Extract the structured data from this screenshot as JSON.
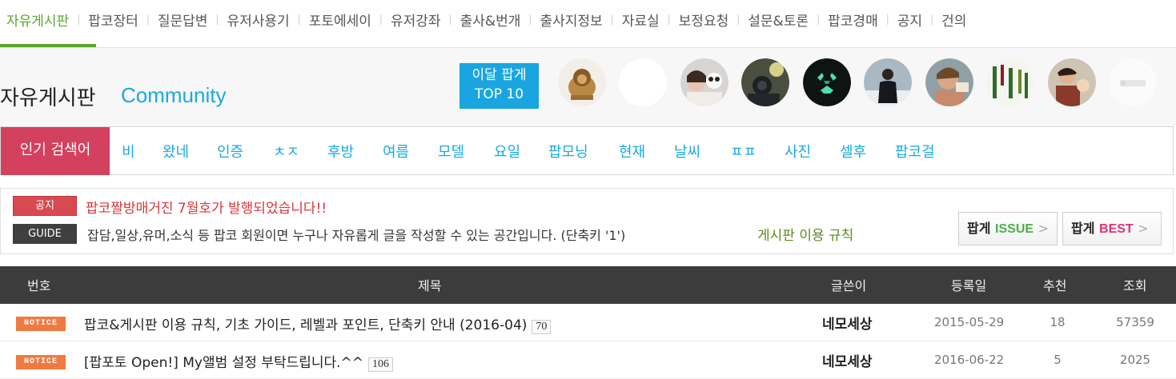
{
  "topnav": {
    "items": [
      {
        "label": "자유게시판",
        "active": true
      },
      {
        "label": "팝코장터"
      },
      {
        "label": "질문답변"
      },
      {
        "label": "유저사용기"
      },
      {
        "label": "포토에세이"
      },
      {
        "label": "유저강좌"
      },
      {
        "label": "출사&번개"
      },
      {
        "label": "출사지정보"
      },
      {
        "label": "자료실"
      },
      {
        "label": "보정요청"
      },
      {
        "label": "설문&토론"
      },
      {
        "label": "팝코경매"
      },
      {
        "label": "공지"
      },
      {
        "label": "건의"
      }
    ]
  },
  "header": {
    "title": "자유게시판",
    "subtitle": "Community",
    "top10_line1": "이달 팝게",
    "top10_line2": "TOP 10"
  },
  "popular": {
    "label": "인기 검색어",
    "keywords": [
      "비",
      "왔네",
      "인증",
      "ㅊㅈ",
      "후방",
      "여름",
      "모델",
      "요일",
      "팝모닝",
      "현재",
      "날씨",
      "ㅍㅍ",
      "사진",
      "셀후",
      "팝코걸"
    ]
  },
  "info": {
    "notice_tag": "공지",
    "notice_text": "팝코짤방매거진 7월호가 발행되었습니다!!",
    "guide_tag": "GUIDE",
    "guide_text": "잡담,일상,유머,소식 등 팝코 회원이면 누구나 자유롭게 글을 작성할 수 있는 공간입니다. (단축키 '1')",
    "guide_link": "게시판 이용 규칙",
    "issue_btn_k": "팝게",
    "issue_btn_e": "ISSUE",
    "best_btn_k": "팝게",
    "best_btn_e": "BEST",
    "arrow": ">"
  },
  "table": {
    "headers": {
      "no": "번호",
      "title": "제목",
      "writer": "글쓴이",
      "date": "등록일",
      "rec": "추천",
      "views": "조회"
    },
    "rows": [
      {
        "badge": "NOTICE",
        "title": "팝코&게시판 이용 규칙, 기초 가이드, 레벨과 포인트, 단축키 안내 (2016-04)",
        "comments": "70",
        "writer": "네모세상",
        "date": "2015-05-29",
        "rec": "18",
        "views": "57359"
      },
      {
        "badge": "NOTICE",
        "title": "[팝포토 Open!] My앨범 설정 부탁드립니다.^^",
        "comments": "106",
        "writer": "네모세상",
        "date": "2016-06-22",
        "rec": "5",
        "views": "2025"
      }
    ]
  },
  "colors": {
    "accent_green": "#5aa62a",
    "accent_blue": "#19a9e1",
    "popular_red": "#d4415e",
    "notice_orange": "#f07a42"
  }
}
